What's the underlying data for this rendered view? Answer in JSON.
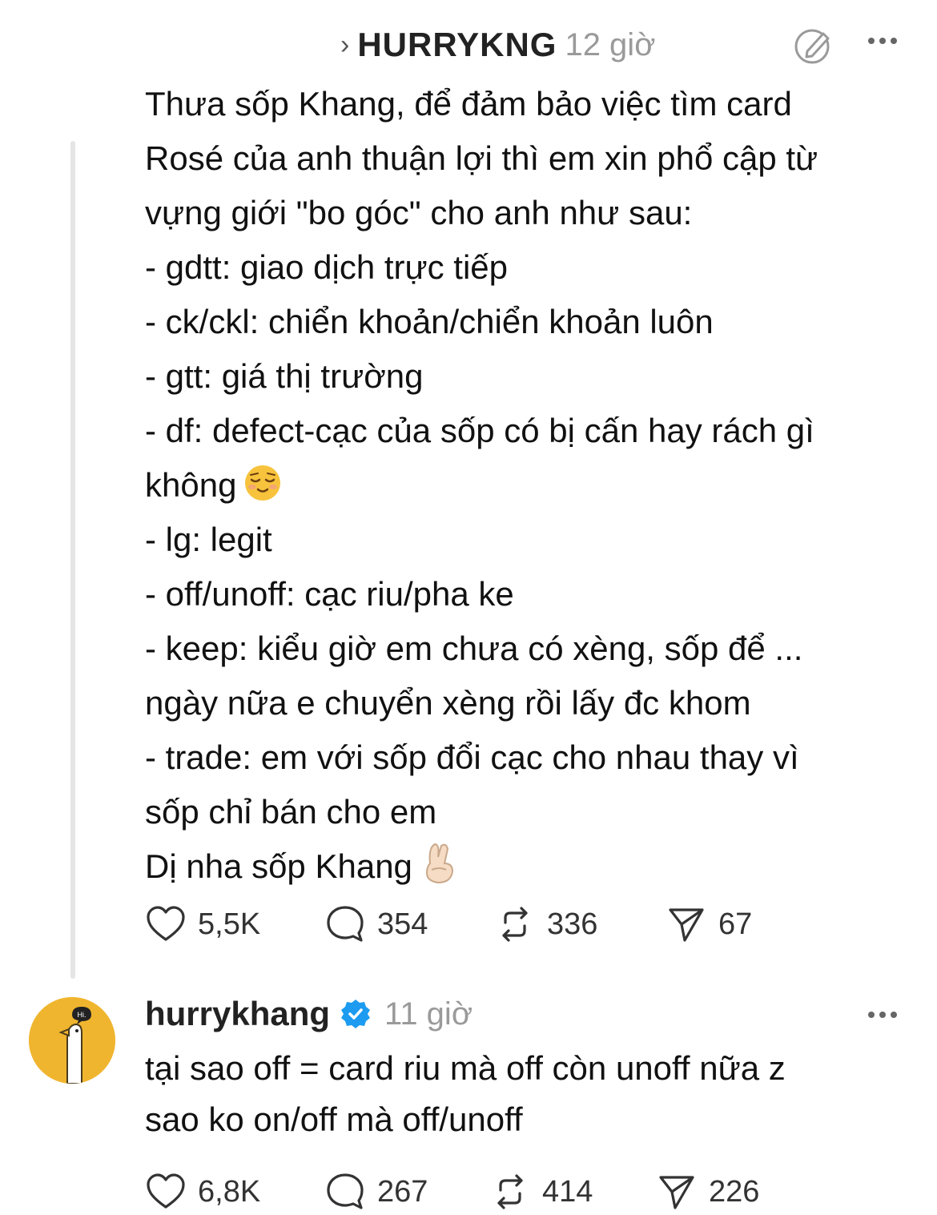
{
  "header": {
    "username": "HURRYKNG",
    "time": "12 giờ"
  },
  "post": {
    "lines": [
      "Thưa sốp Khang, để đảm bảo việc tìm card",
      "Rosé của anh thuận lợi thì em xin phổ cập từ",
      "vựng giới \"bo góc\" cho anh như sau:",
      "- gdtt: giao dịch trực tiếp",
      "- ck/ckl: chiển khoản/chiển khoản luôn",
      "- gtt: giá thị trường",
      "- df: defect-cạc của sốp có bị cấn hay rách gì",
      "không",
      "- lg: legit",
      "- off/unoff: cạc riu/pha ke",
      "- keep: kiểu giờ em chưa có xèng, sốp để ...",
      "ngày nữa e chuyển xèng rồi lấy đc khom",
      "- trade: em với sốp đổi cạc cho nhau thay vì",
      "sốp chỉ bán cho em",
      "Dị nha sốp Khang"
    ],
    "stats": {
      "likes": "5,5K",
      "replies": "354",
      "reposts": "336",
      "shares": "67"
    }
  },
  "reply": {
    "username": "hurrykhang",
    "time": "11 giờ",
    "avatar_text": "Hi.",
    "lines": [
      "tại sao off = card riu mà off còn unoff nữa z",
      "sao ko on/off mà off/unoff"
    ],
    "stats": {
      "likes": "6,8K",
      "replies": "267",
      "reposts": "414",
      "shares": "226"
    }
  },
  "colors": {
    "avatar_bg": "#f0b52e",
    "verified": "#1d9bf0",
    "muted": "#9a9a9a"
  }
}
